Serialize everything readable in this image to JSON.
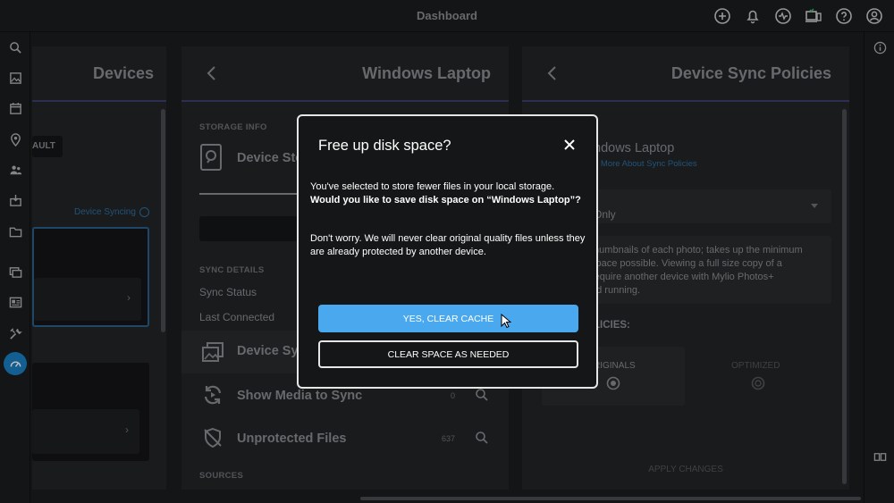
{
  "app": {
    "title": "Dashboard"
  },
  "topbar": {
    "icons": [
      "add-icon",
      "bell-icon",
      "activity-icon",
      "devices-icon",
      "help-icon",
      "account-icon"
    ]
  },
  "sidebar": {
    "icons": [
      "search-icon",
      "photos-icon",
      "calendar-icon",
      "map-pin-icon",
      "people-icon",
      "import-icon",
      "folder-icon",
      "albums-icon",
      "info-card-icon",
      "tools-icon",
      "dashboard-icon"
    ],
    "active": "dashboard-icon"
  },
  "panels": {
    "devices": {
      "title": "Devices",
      "default_badge": "AULT",
      "device_syncing_label": "Device Syncing"
    },
    "windows_laptop": {
      "title": "Windows Laptop",
      "storage_info_label": "STORAGE INFO",
      "device_storage_label": "Device Sto",
      "sync_details_label": "SYNC DETAILS",
      "sync_status_label": "Sync Status",
      "last_connected_label": "Last Connected",
      "device_sync_label": "Device Sy",
      "show_media_label": "Show Media to Sync",
      "show_media_count": "0",
      "unprotected_label": "Unprotected Files",
      "unprotected_count": "637",
      "sources_label": "SOURCES"
    },
    "sync_policies": {
      "title": "Device Sync Policies",
      "device_name": "ndows Laptop",
      "learn_more": "n More About Sync Policies",
      "dropdown_value": "Only",
      "description_lines": [
        "thumbnails of each photo; takes up the minimum",
        "space possible. Viewing a full size copy of a",
        "require another device with Mylio Photos+",
        "nd running."
      ],
      "policies_label": "LICIES:",
      "originals_label": "RIGINALS",
      "optimized_label": "OPTIMIZED",
      "apply_label": "APPLY CHANGES"
    }
  },
  "modal": {
    "title": "Free up disk space?",
    "line1": "You've selected to store fewer files in your local storage.",
    "line2_bold": "Would you like to save disk space on “Windows Laptop”?",
    "line3": "Don't worry. We will never clear original quality files unless they are already protected by another device.",
    "primary_button": "YES, CLEAR CACHE",
    "secondary_button": "CLEAR SPACE AS NEEDED"
  },
  "colors": {
    "accent": "#4aa8ee",
    "active_sidebar": "#1a7fc2",
    "panel_underline": "#3b3f6b"
  }
}
